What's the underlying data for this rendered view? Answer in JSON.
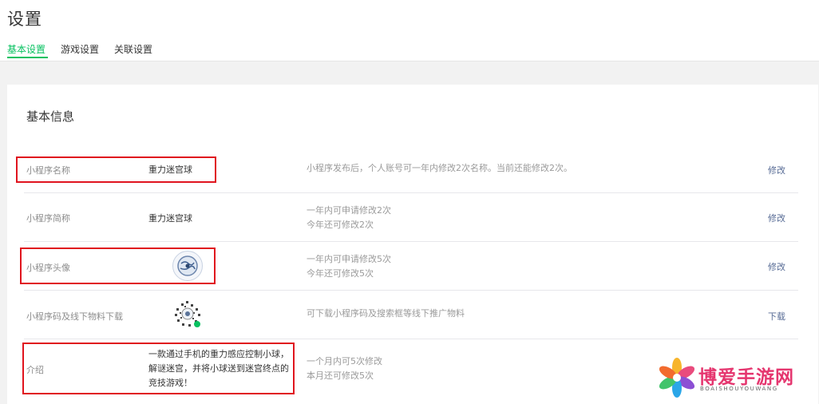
{
  "header": {
    "title": "设置",
    "tabs": [
      {
        "label": "基本设置",
        "active": true
      },
      {
        "label": "游戏设置",
        "active": false
      },
      {
        "label": "关联设置",
        "active": false
      }
    ]
  },
  "section": {
    "title": "基本信息"
  },
  "rows": [
    {
      "label": "小程序名称",
      "value": "重力迷宫球",
      "desc": [
        "小程序发布后，个人账号可一年内修改2次名称。当前还能修改2次。"
      ],
      "action": "修改"
    },
    {
      "label": "小程序简称",
      "value": "重力迷宫球",
      "desc": [
        "一年内可申请修改2次",
        "今年还可修改2次"
      ],
      "action": "修改"
    },
    {
      "label": "小程序头像",
      "value": "",
      "desc": [
        "一年内可申请修改5次",
        "今年还可修改5次"
      ],
      "action": "修改"
    },
    {
      "label": "小程序码及线下物料下载",
      "value": "",
      "desc": [
        "可下载小程序码及搜索框等线下推广物料"
      ],
      "action": "下载"
    },
    {
      "label": "介绍",
      "value_lines": [
        "一款通过手机的重力感应控制小球，",
        "解谜迷宫，并将小球送到迷宫终点的",
        "竞技游戏！"
      ],
      "desc": [
        "一个月内可5次修改",
        "本月还可修改5次"
      ],
      "action": ""
    }
  ],
  "watermark": {
    "text": "博爱手游网",
    "sub": "BOAISHOUYOUWANG"
  },
  "colors": {
    "accent": "#07c160",
    "link": "#576b95",
    "highlight": "#e0141e"
  }
}
